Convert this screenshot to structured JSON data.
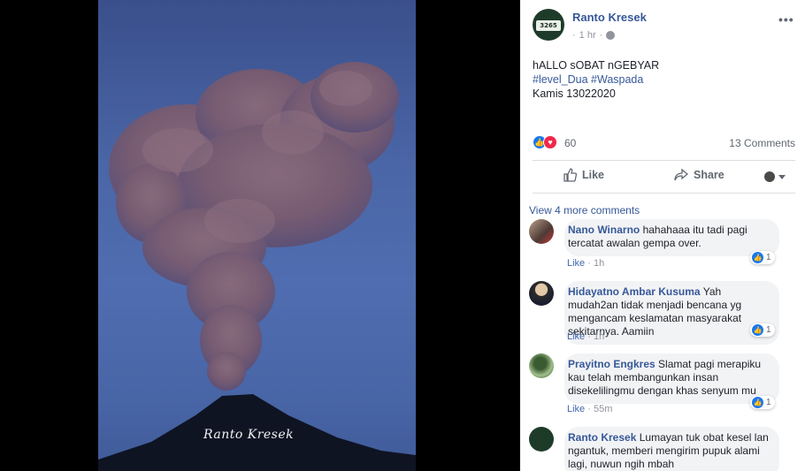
{
  "photo": {
    "watermark": "Ranto Kresek"
  },
  "post": {
    "author": "Ranto Kresek",
    "avatar_plate": "3265",
    "time": "1 hr",
    "text_line1": "hALLO sOBAT nGEBYAR",
    "hashtag1": "#level_Dua",
    "hashtag2": "#Waspada",
    "text_line3": "Kamis 13022020",
    "reaction_count": "60",
    "comments_count": "13 Comments",
    "like_label": "Like",
    "share_label": "Share"
  },
  "comments": {
    "view_more": "View 4 more comments",
    "items": [
      {
        "name": "Nano Winarno",
        "text": "hahahaaa itu tadi pagi tercatat awalan gempa over.",
        "like": "Like",
        "time": "1h",
        "reacts": "1"
      },
      {
        "name": "Hidayatno Ambar Kusuma",
        "text": "Yah mudah2an tidak menjadi bencana yg mengancam keslamatan masyarakat sekitarnya. Aamiin",
        "like": "Like",
        "time": "1h",
        "reacts": "1"
      },
      {
        "name": "Prayitno Engkres",
        "text": "Slamat pagi merapiku kau telah membangunkan insan disekelilingmu dengan khas senyum mu",
        "like": "Like",
        "time": "55m",
        "reacts": "1"
      },
      {
        "name": "Ranto Kresek",
        "text": "Lumayan tuk obat kesel lan ngantuk, memberi mengirim pupuk alami lagi, nuwun ngih mbah",
        "like": "",
        "time": "",
        "reacts": ""
      }
    ]
  },
  "colors": {
    "link": "#365899",
    "like_blue": "#1877f2",
    "love_red": "#f0284a",
    "bubble_bg": "#f2f3f5"
  },
  "icons": [
    "globe-icon",
    "more-options-icon",
    "like-thumb-icon",
    "share-arrow-icon",
    "caret-down-icon",
    "love-heart-icon"
  ]
}
